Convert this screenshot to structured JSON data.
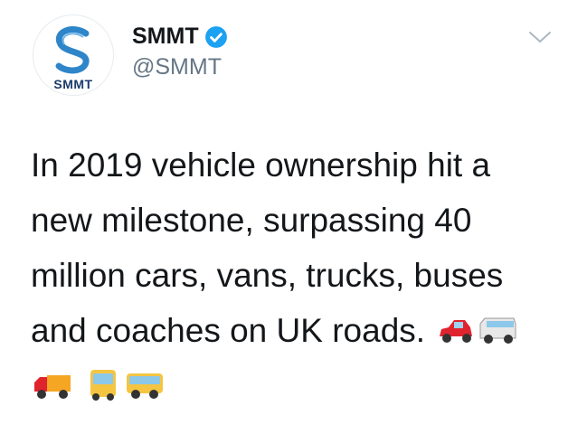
{
  "account": {
    "avatar_text": "SMMT",
    "display_name": "SMMT",
    "handle": "@SMMT",
    "verified": true
  },
  "tweet": {
    "text": "In 2019 vehicle ownership hit a new milestone, surpassing 40 million cars, vans, trucks, buses and coaches on UK roads.",
    "emojis": [
      "red-car-icon",
      "minibus-icon",
      "delivery-truck-icon",
      "bus-icon",
      "coach-bus-icon"
    ]
  },
  "menu": {
    "icon": "chevron-down-icon"
  },
  "colors": {
    "verified_blue": "#1da1f2",
    "text": "#14171a",
    "secondary": "#657786",
    "brand_blue": "#1a3a6b"
  }
}
